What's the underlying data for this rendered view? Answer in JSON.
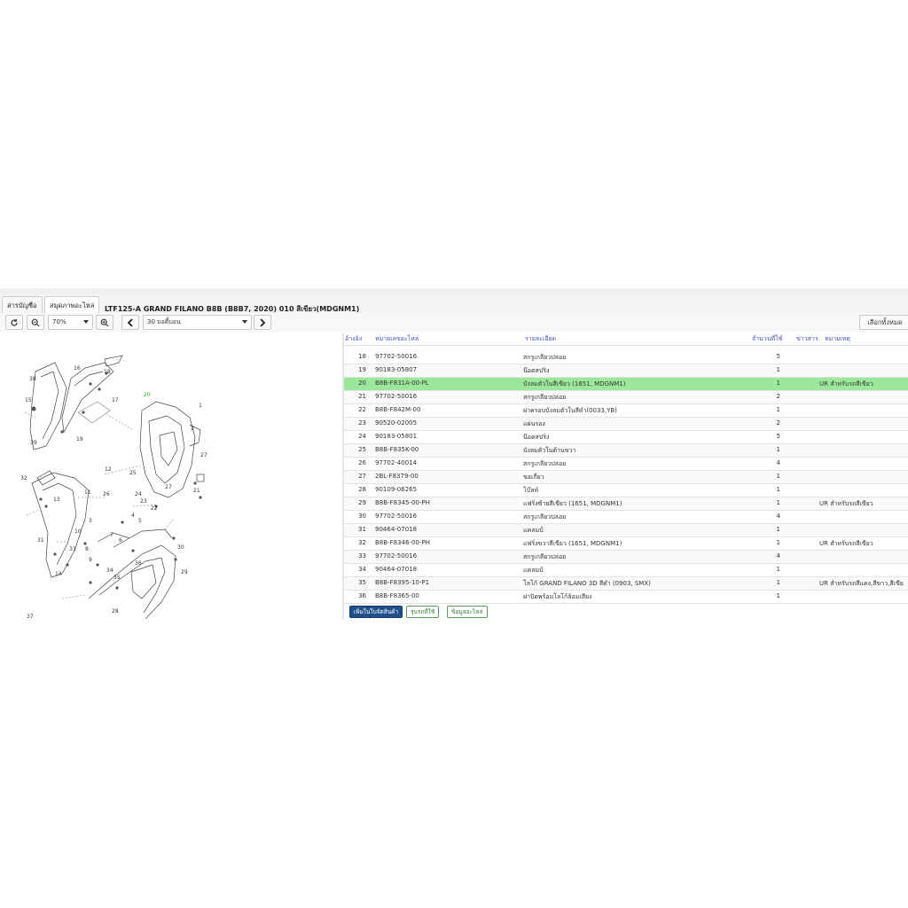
{
  "tabs": [
    {
      "label": "สารบัญชื่อ"
    },
    {
      "label": "สมุดภาพอะไหล่"
    }
  ],
  "title": "LTF125-A GRAND FILANO B8B (B8B7, 2020) 010 สีเขียว(MDGNM1)",
  "toolbar": {
    "zoom_value": "70%",
    "section_value": "30 บอดี้บอน",
    "select_all_label": "เลือกทั้งหมด"
  },
  "diagram": {
    "callouts": [
      "38",
      "16",
      "18",
      "15",
      "19",
      "17",
      "39",
      "1",
      "27",
      "2",
      "27",
      "12",
      "25",
      "26",
      "21",
      "13",
      "32",
      "11",
      "10",
      "24",
      "23",
      "22",
      "31",
      "4",
      "5",
      "33",
      "8",
      "9",
      "14",
      "30",
      "36",
      "29",
      "34",
      "35",
      "28",
      "3",
      "6",
      "7",
      "20",
      "37"
    ],
    "highlighted_callout": "20"
  },
  "table": {
    "headers": {
      "no": "อ้างอิง",
      "part": "หมายเลขอะไหล่",
      "desc": "รายละเอียด",
      "qty": "จำนวนที่ใช้",
      "news": "ข่าวสาร",
      "note": "หมายเหตุ"
    },
    "rows": [
      {
        "no": "18",
        "part": "97702-50016",
        "desc": "สกรูเกลียวปล่อย",
        "qty": "5",
        "note": ""
      },
      {
        "no": "19",
        "part": "90183-05807",
        "desc": "น๊อตสปริง",
        "qty": "1",
        "note": ""
      },
      {
        "no": "20",
        "part": "B8B-F831A-00-PL",
        "desc": "บังลมตัวในสีเขียว (1651, MDGNM1)",
        "qty": "1",
        "note": "UR สำหรับรถสีเขียว"
      },
      {
        "no": "21",
        "part": "97702-50016",
        "desc": "สกรูเกลียวปล่อย",
        "qty": "2",
        "note": ""
      },
      {
        "no": "22",
        "part": "B8B-F842M-00",
        "desc": "ฝาครอบบังลมตัวในสีดำ(0033,YB)",
        "qty": "1",
        "note": ""
      },
      {
        "no": "23",
        "part": "90520-02005",
        "desc": "แผ่นรอง",
        "qty": "2",
        "note": ""
      },
      {
        "no": "24",
        "part": "90183-05801",
        "desc": "น๊อตสปริง",
        "qty": "5",
        "note": ""
      },
      {
        "no": "25",
        "part": "B8B-F835K-00",
        "desc": "บังลมตัวในด้านขวา",
        "qty": "1",
        "note": ""
      },
      {
        "no": "26",
        "part": "97702-40014",
        "desc": "สกรูเกลียวปล่อย",
        "qty": "4",
        "note": ""
      },
      {
        "no": "27",
        "part": "2BL-F8379-00",
        "desc": "ขอเกี่ยว",
        "qty": "1",
        "note": ""
      },
      {
        "no": "28",
        "part": "90109-06265",
        "desc": "โบ๊ลท์",
        "qty": "1",
        "note": ""
      },
      {
        "no": "29",
        "part": "B8B-F8345-00-PH",
        "desc": "แฟริ่งซ้ายสีเขียว (1651, MDGNM1)",
        "qty": "1",
        "note": "UR สำหรับรถสีเขียว"
      },
      {
        "no": "30",
        "part": "97702-50016",
        "desc": "สกรูเกลียวปล่อย",
        "qty": "4",
        "note": ""
      },
      {
        "no": "31",
        "part": "90464-07018",
        "desc": "แคลมป์",
        "qty": "1",
        "note": ""
      },
      {
        "no": "32",
        "part": "B8B-F8346-00-PH",
        "desc": "แฟริ่งขวาสีเขียว (1651, MDGNM1)",
        "qty": "1",
        "note": "UR สำหรับรถสีเขียว"
      },
      {
        "no": "33",
        "part": "97702-50016",
        "desc": "สกรูเกลียวปล่อย",
        "qty": "4",
        "note": ""
      },
      {
        "no": "34",
        "part": "90464-07018",
        "desc": "แคลมป์",
        "qty": "1",
        "note": ""
      },
      {
        "no": "35",
        "part": "B8B-F8395-10-P1",
        "desc": "โลโก้ GRAND FILANO 3D สีดำ (0903, SMX)",
        "qty": "1",
        "note": "UR สำหรับรถสีแดง,สีขาว,สีเขีย"
      },
      {
        "no": "36",
        "part": "B8B-F8365-00",
        "desc": "ฝาปิดพร้อมโลโก้ล้อมเสียง",
        "qty": "1",
        "note": ""
      }
    ],
    "highlighted_row": "20"
  },
  "actions": {
    "add_to_list": "เพิ่มในใบจัดสินค้า",
    "models": "รุ่นรถที่ใช้",
    "part_info": "ข้อมูลอะไหล่"
  },
  "colors": {
    "highlight": "#9be89b",
    "header_text": "#4a4fb0",
    "primary_button": "#1f4f8a"
  },
  "icons": [
    "refresh-icon",
    "zoom-out-icon",
    "zoom-in-icon",
    "prev-icon",
    "next-icon",
    "chevron-down-icon"
  ]
}
